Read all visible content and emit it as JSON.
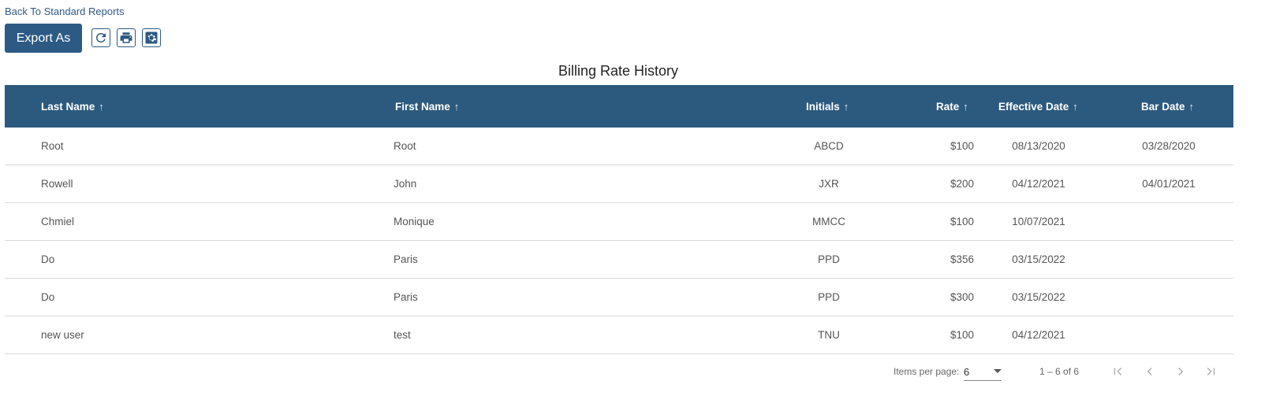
{
  "nav": {
    "back_link": "Back To Standard Reports"
  },
  "toolbar": {
    "export_label": "Export As",
    "icons": [
      "refresh-icon",
      "print-icon",
      "settings-icon"
    ]
  },
  "report": {
    "title": "Billing Rate History"
  },
  "table": {
    "columns": [
      "Last Name",
      "First Name",
      "Initials",
      "Rate",
      "Effective Date",
      "Bar Date"
    ],
    "sort_indicator": "↑",
    "rows": [
      [
        "Root",
        "Root",
        "ABCD",
        "$100",
        "08/13/2020",
        "03/28/2020"
      ],
      [
        "Rowell",
        "John",
        "JXR",
        "$200",
        "04/12/2021",
        "04/01/2021"
      ],
      [
        "Chmiel",
        "Monique",
        "MMCC",
        "$100",
        "10/07/2021",
        ""
      ],
      [
        "Do",
        "Paris",
        "PPD",
        "$356",
        "03/15/2022",
        ""
      ],
      [
        "Do",
        "Paris",
        "PPD",
        "$300",
        "03/15/2022",
        ""
      ],
      [
        "new user",
        "test",
        "TNU",
        "$100",
        "04/12/2021",
        ""
      ]
    ]
  },
  "paginator": {
    "items_per_page_label": "Items per page:",
    "items_per_page_value": "6",
    "range_label": "1 – 6 of 6"
  },
  "colors": {
    "header_bg": "#2c5a7f",
    "button_bg": "#2c5a84",
    "link": "#2d5a87"
  }
}
